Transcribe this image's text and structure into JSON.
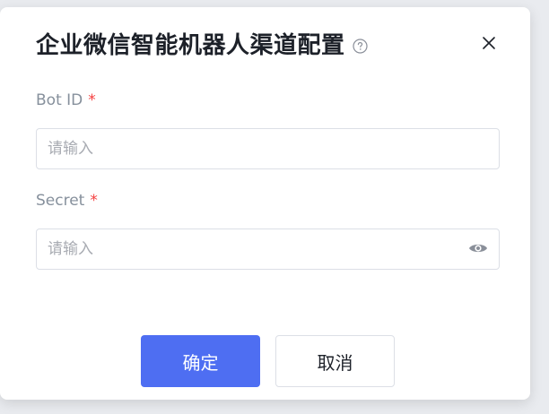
{
  "dialog": {
    "title": "企业微信智能机器人渠道配置",
    "help_icon": "question-circle-icon",
    "close_icon": "close-icon"
  },
  "fields": {
    "bot_id": {
      "label": "Bot ID",
      "required_mark": "*",
      "placeholder": "请输入",
      "value": ""
    },
    "secret": {
      "label": "Secret",
      "required_mark": "*",
      "placeholder": "请输入",
      "value": "",
      "toggle_icon": "eye-icon"
    }
  },
  "footer": {
    "confirm_label": "确定",
    "cancel_label": "取消"
  },
  "colors": {
    "primary": "#4e6ef2",
    "required": "#f53f3f",
    "label": "#86909c",
    "border": "#dcdfe6"
  }
}
